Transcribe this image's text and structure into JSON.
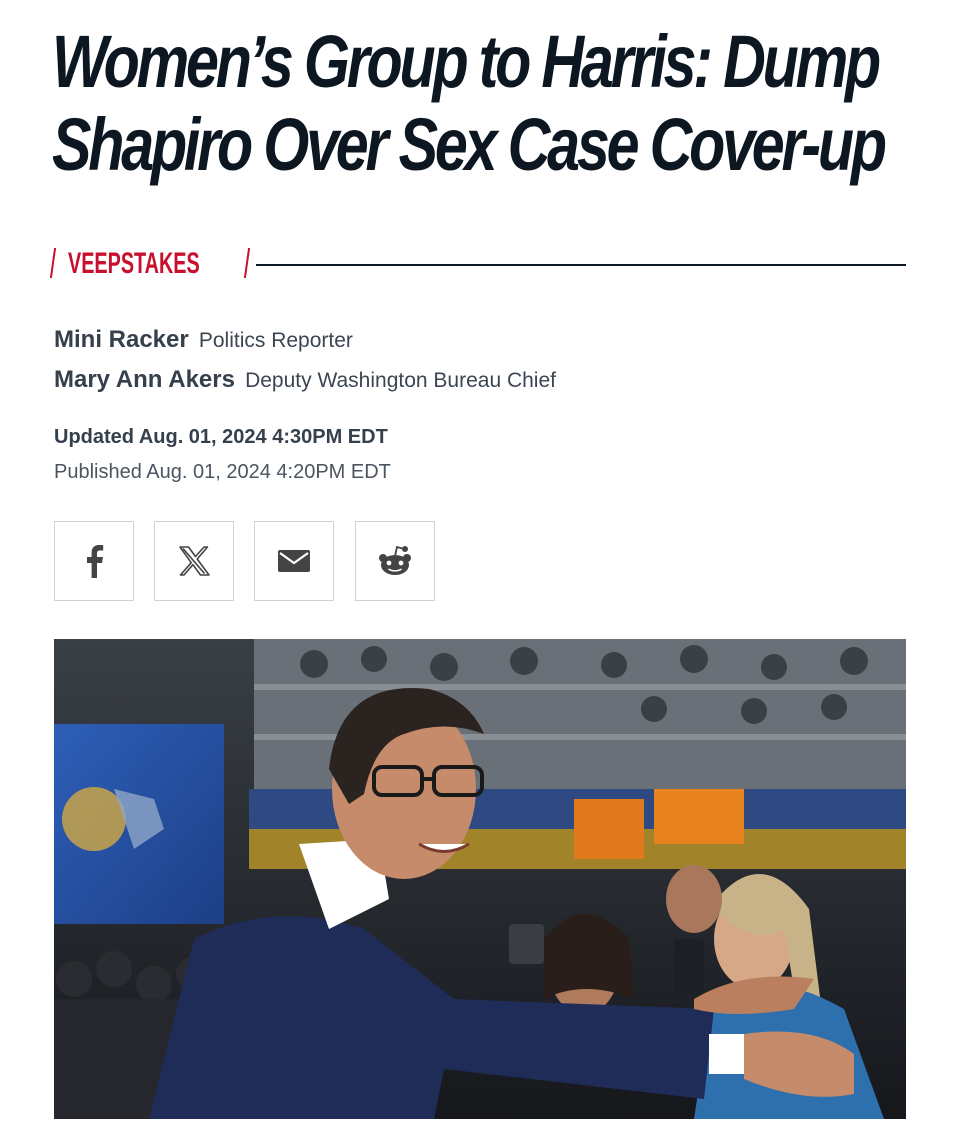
{
  "article": {
    "headline": "Women’s Group to Harris: Dump Shapiro Over Sex Case Cover-up",
    "section": "VEEPSTAKES"
  },
  "authors": [
    {
      "name": "Mini Racker",
      "role": "Politics Reporter"
    },
    {
      "name": "Mary Ann Akers",
      "role": "Deputy Washington Bureau Chief"
    }
  ],
  "dates": {
    "updated": "Updated Aug. 01, 2024 4:30PM EDT",
    "published": "Published Aug. 01, 2024 4:20PM EDT"
  },
  "share": [
    {
      "icon": "facebook-icon"
    },
    {
      "icon": "x-icon"
    },
    {
      "icon": "email-icon"
    },
    {
      "icon": "reddit-icon"
    }
  ],
  "colors": {
    "accent": "#c8102e",
    "headline": "#0d1722"
  }
}
